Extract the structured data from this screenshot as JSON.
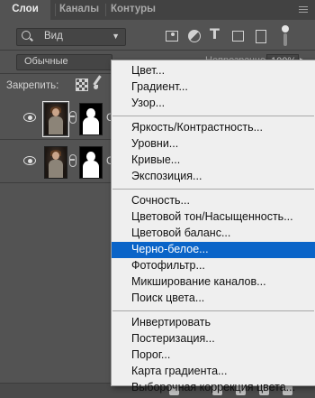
{
  "tabs": {
    "layers": "Слои",
    "channels": "Каналы",
    "paths": "Контуры"
  },
  "filter": {
    "kind_label": "Вид",
    "icons": [
      "image-filter-icon",
      "adjustment-filter-icon",
      "type-filter-icon",
      "shape-filter-icon",
      "smart-object-filter-icon"
    ]
  },
  "blend": {
    "mode": "Обычные",
    "opacity_label": "Непрозрачность:",
    "opacity_value": "100%"
  },
  "lock": {
    "label": "Закрепить:"
  },
  "layers": [
    {
      "name_stub": "С"
    },
    {
      "name_stub": "С"
    }
  ],
  "menu": {
    "groups": [
      [
        "Цвет...",
        "Градиент...",
        "Узор..."
      ],
      [
        "Яркость/Контрастность...",
        "Уровни...",
        "Кривые...",
        "Экспозиция..."
      ],
      [
        "Сочность...",
        "Цветовой тон/Насыщенность...",
        "Цветовой баланс...",
        "Черно-белое...",
        "Фотофильтр...",
        "Микширование каналов...",
        "Поиск цвета..."
      ],
      [
        "Инвертировать",
        "Постеризация...",
        "Порог...",
        "Карта градиента...",
        "Выборочная коррекция цвета..."
      ]
    ],
    "highlighted": "Черно-белое...",
    "highlight_color": "#0a64c8"
  }
}
